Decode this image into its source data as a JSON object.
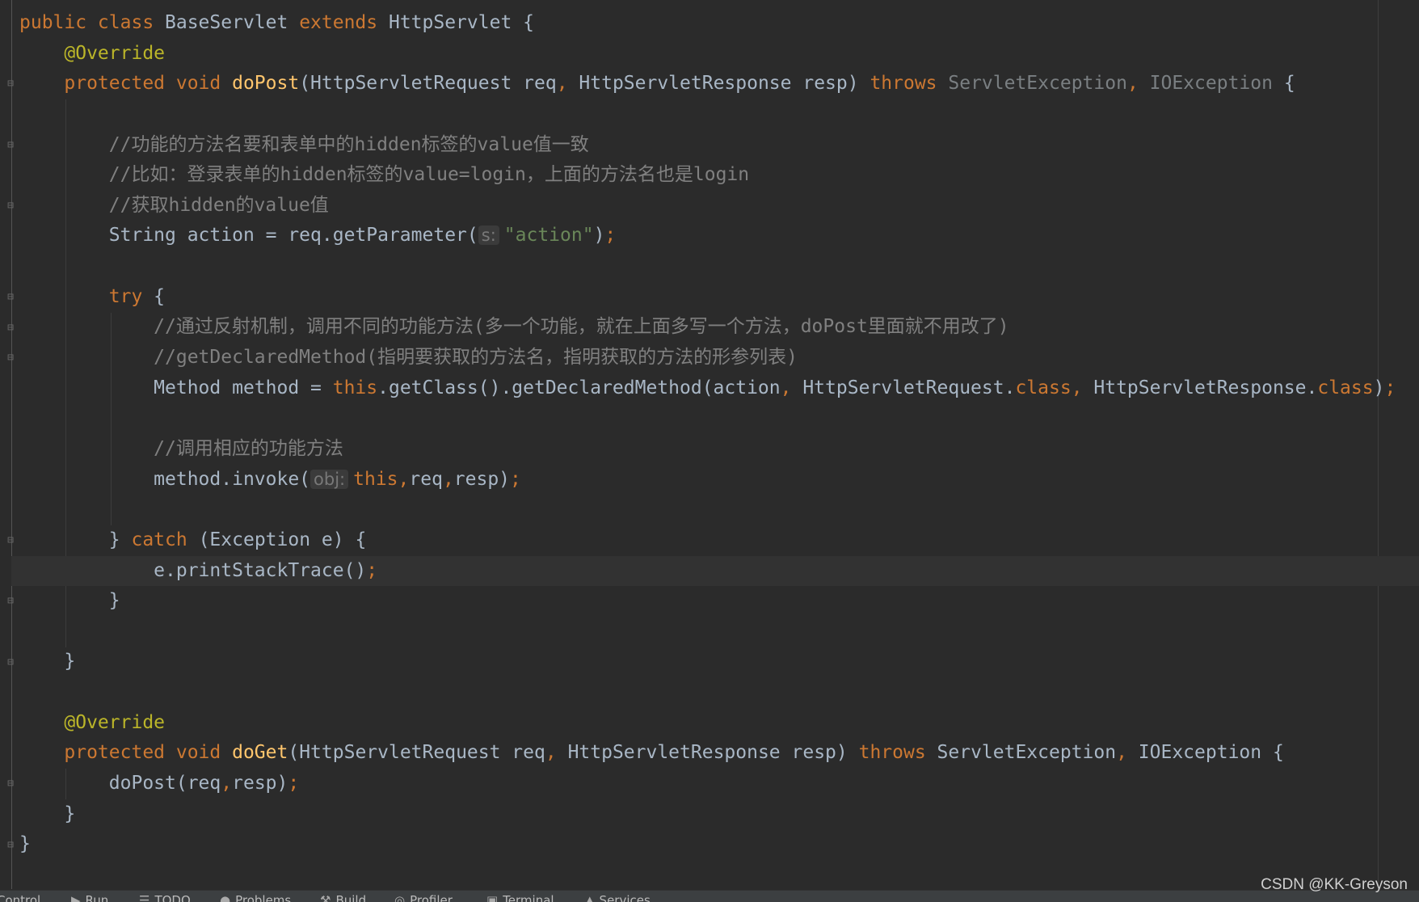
{
  "editor": {
    "lines": [
      {
        "indent": 0,
        "tokens": [
          {
            "t": "public class ",
            "c": "kw"
          },
          {
            "t": "BaseServlet ",
            "c": "txt"
          },
          {
            "t": "extends ",
            "c": "kw"
          },
          {
            "t": "HttpServlet {",
            "c": "txt"
          }
        ]
      },
      {
        "indent": 4,
        "tokens": [
          {
            "t": "@Override",
            "c": "ann"
          }
        ]
      },
      {
        "indent": 4,
        "tokens": [
          {
            "t": "protected void ",
            "c": "kw"
          },
          {
            "t": "doPost",
            "c": "fn"
          },
          {
            "t": "(HttpServletRequest req",
            "c": "txt"
          },
          {
            "t": ", ",
            "c": "kw"
          },
          {
            "t": "HttpServletResponse resp) ",
            "c": "txt"
          },
          {
            "t": "throws ",
            "c": "kw"
          },
          {
            "t": "ServletException",
            "c": "dim"
          },
          {
            "t": ", ",
            "c": "kw"
          },
          {
            "t": "IOException ",
            "c": "dim"
          },
          {
            "t": "{",
            "c": "txt"
          }
        ]
      },
      {
        "indent": 0,
        "tokens": []
      },
      {
        "indent": 8,
        "tokens": [
          {
            "t": "//功能的方法名要和表单中的hidden标签的value值一致",
            "c": "cm"
          }
        ]
      },
      {
        "indent": 8,
        "tokens": [
          {
            "t": "//比如：登录表单的hidden标签的value=login，上面的方法名也是login",
            "c": "cm"
          }
        ]
      },
      {
        "indent": 8,
        "tokens": [
          {
            "t": "//获取hidden的value值",
            "c": "cm"
          }
        ]
      },
      {
        "indent": 8,
        "tokens": [
          {
            "t": "String action = req.getParameter(",
            "c": "txt"
          },
          {
            "t": "s:",
            "c": "hint"
          },
          {
            "t": "\"action\"",
            "c": "str"
          },
          {
            "t": ")",
            "c": "txt"
          },
          {
            "t": ";",
            "c": "kw"
          }
        ]
      },
      {
        "indent": 0,
        "tokens": []
      },
      {
        "indent": 8,
        "tokens": [
          {
            "t": "try ",
            "c": "kw"
          },
          {
            "t": "{",
            "c": "txt"
          }
        ]
      },
      {
        "indent": 12,
        "tokens": [
          {
            "t": "//通过反射机制，调用不同的功能方法(多一个功能，就在上面多写一个方法，doPost里面就不用改了)",
            "c": "cm"
          }
        ]
      },
      {
        "indent": 12,
        "tokens": [
          {
            "t": "//getDeclaredMethod(指明要获取的方法名，指明获取的方法的形参列表)",
            "c": "cm"
          }
        ]
      },
      {
        "indent": 12,
        "tokens": [
          {
            "t": "Method method = ",
            "c": "txt"
          },
          {
            "t": "this",
            "c": "kw"
          },
          {
            "t": ".getClass().getDeclaredMethod(action",
            "c": "txt"
          },
          {
            "t": ", ",
            "c": "kw"
          },
          {
            "t": "HttpServletRequest.",
            "c": "txt"
          },
          {
            "t": "class",
            "c": "kw"
          },
          {
            "t": ", ",
            "c": "kw"
          },
          {
            "t": "HttpServletResponse.",
            "c": "txt"
          },
          {
            "t": "class",
            "c": "kw"
          },
          {
            "t": ")",
            "c": "txt"
          },
          {
            "t": ";",
            "c": "kw"
          }
        ]
      },
      {
        "indent": 0,
        "tokens": []
      },
      {
        "indent": 12,
        "tokens": [
          {
            "t": "//调用相应的功能方法",
            "c": "cm"
          }
        ]
      },
      {
        "indent": 12,
        "tokens": [
          {
            "t": "method.invoke(",
            "c": "txt"
          },
          {
            "t": "obj:",
            "c": "hint"
          },
          {
            "t": "this",
            "c": "kw"
          },
          {
            "t": ",",
            "c": "kw"
          },
          {
            "t": "req",
            "c": "txt"
          },
          {
            "t": ",",
            "c": "kw"
          },
          {
            "t": "resp)",
            "c": "txt"
          },
          {
            "t": ";",
            "c": "kw"
          }
        ]
      },
      {
        "indent": 0,
        "tokens": []
      },
      {
        "indent": 8,
        "tokens": [
          {
            "t": "} ",
            "c": "txt"
          },
          {
            "t": "catch ",
            "c": "kw"
          },
          {
            "t": "(Exception e) {",
            "c": "txt"
          }
        ]
      },
      {
        "indent": 12,
        "current": true,
        "tokens": [
          {
            "t": "e.printStackTrace()",
            "c": "txt"
          },
          {
            "t": ";",
            "c": "kw"
          }
        ]
      },
      {
        "indent": 8,
        "tokens": [
          {
            "t": "}",
            "c": "txt"
          }
        ]
      },
      {
        "indent": 0,
        "tokens": []
      },
      {
        "indent": 4,
        "tokens": [
          {
            "t": "}",
            "c": "txt"
          }
        ]
      },
      {
        "indent": 0,
        "tokens": []
      },
      {
        "indent": 4,
        "tokens": [
          {
            "t": "@Override",
            "c": "ann"
          }
        ]
      },
      {
        "indent": 4,
        "tokens": [
          {
            "t": "protected void ",
            "c": "kw"
          },
          {
            "t": "doGet",
            "c": "fn"
          },
          {
            "t": "(HttpServletRequest req",
            "c": "txt"
          },
          {
            "t": ", ",
            "c": "kw"
          },
          {
            "t": "HttpServletResponse resp) ",
            "c": "txt"
          },
          {
            "t": "throws ",
            "c": "kw"
          },
          {
            "t": "ServletException",
            "c": "txt"
          },
          {
            "t": ", ",
            "c": "kw"
          },
          {
            "t": "IOException {",
            "c": "txt"
          }
        ]
      },
      {
        "indent": 8,
        "tokens": [
          {
            "t": "doPost(req",
            "c": "txt"
          },
          {
            "t": ",",
            "c": "kw"
          },
          {
            "t": "resp)",
            "c": "txt"
          },
          {
            "t": ";",
            "c": "kw"
          }
        ]
      },
      {
        "indent": 4,
        "tokens": [
          {
            "t": "}",
            "c": "txt"
          }
        ]
      },
      {
        "indent": 0,
        "tokens": [
          {
            "t": "}",
            "c": "txt"
          }
        ]
      }
    ]
  },
  "toolbar": {
    "items": [
      {
        "label": "Control",
        "icon": ""
      },
      {
        "label": "Run",
        "icon": "▶"
      },
      {
        "label": "TODO",
        "icon": "☰"
      },
      {
        "label": "Problems",
        "icon": "●"
      },
      {
        "label": "Build",
        "icon": "⚒"
      },
      {
        "label": "Profiler",
        "icon": "◎"
      },
      {
        "label": "Terminal",
        "icon": "▣"
      },
      {
        "label": "Services",
        "icon": "▲"
      }
    ]
  },
  "watermark": "CSDN @KK-Greyson",
  "colors": {
    "background": "#2b2b2b",
    "keyword": "#cc7832",
    "annotation": "#bbb529",
    "method": "#ffc66d",
    "text": "#a9b7c6",
    "comment": "#808080",
    "string": "#6a8759"
  }
}
